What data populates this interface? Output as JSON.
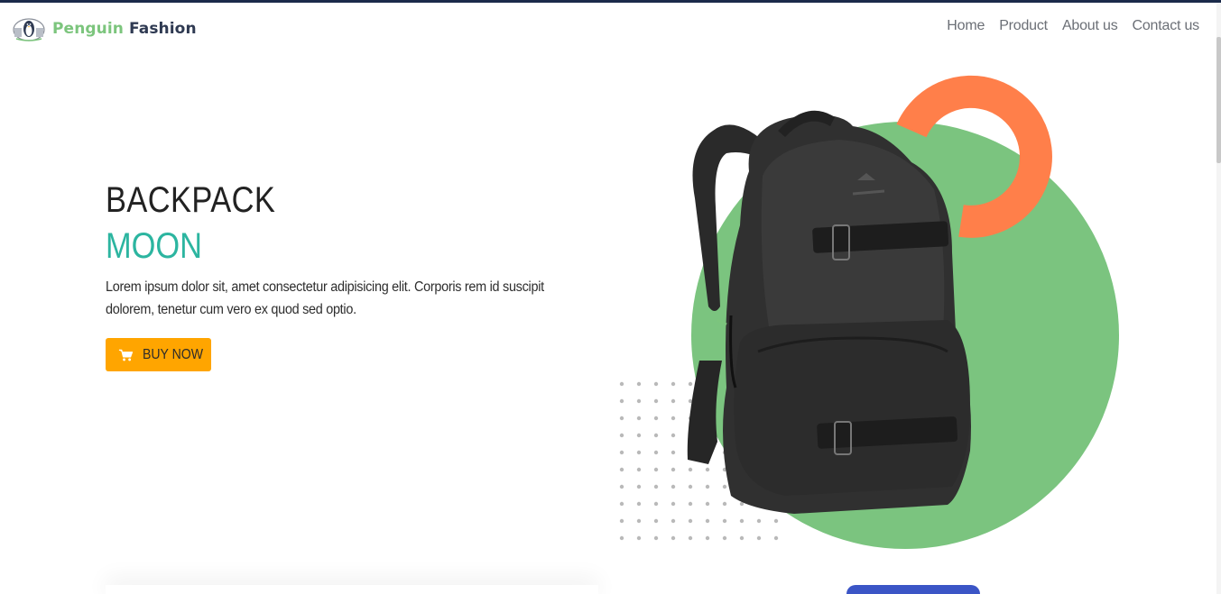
{
  "brand": {
    "name_part1": "Penguin",
    "name_part2": "Fashion",
    "logo_icon": "penguin-logo-icon"
  },
  "nav": {
    "links": [
      "Home",
      "Product",
      "About us",
      "Contact us"
    ]
  },
  "hero": {
    "title": "BACKPACK",
    "subtitle": "MOON",
    "description": "Lorem ipsum dolor sit, amet consectetur adipisicing elit. Corporis rem id suscipit dolorem, tenetur cum vero ex quod sed optio.",
    "button_label": "BUY NOW",
    "button_icon": "cart-icon",
    "image": "backpack-image"
  },
  "colors": {
    "brand_green": "#7cc57d",
    "brand_dark": "#2f3a52",
    "accent_teal": "#2cb5a0",
    "button_orange": "#ffa500",
    "circle_green": "#7bc47f",
    "ring_orange": "#ff7f4a",
    "top_line": "#1b2a4a"
  }
}
